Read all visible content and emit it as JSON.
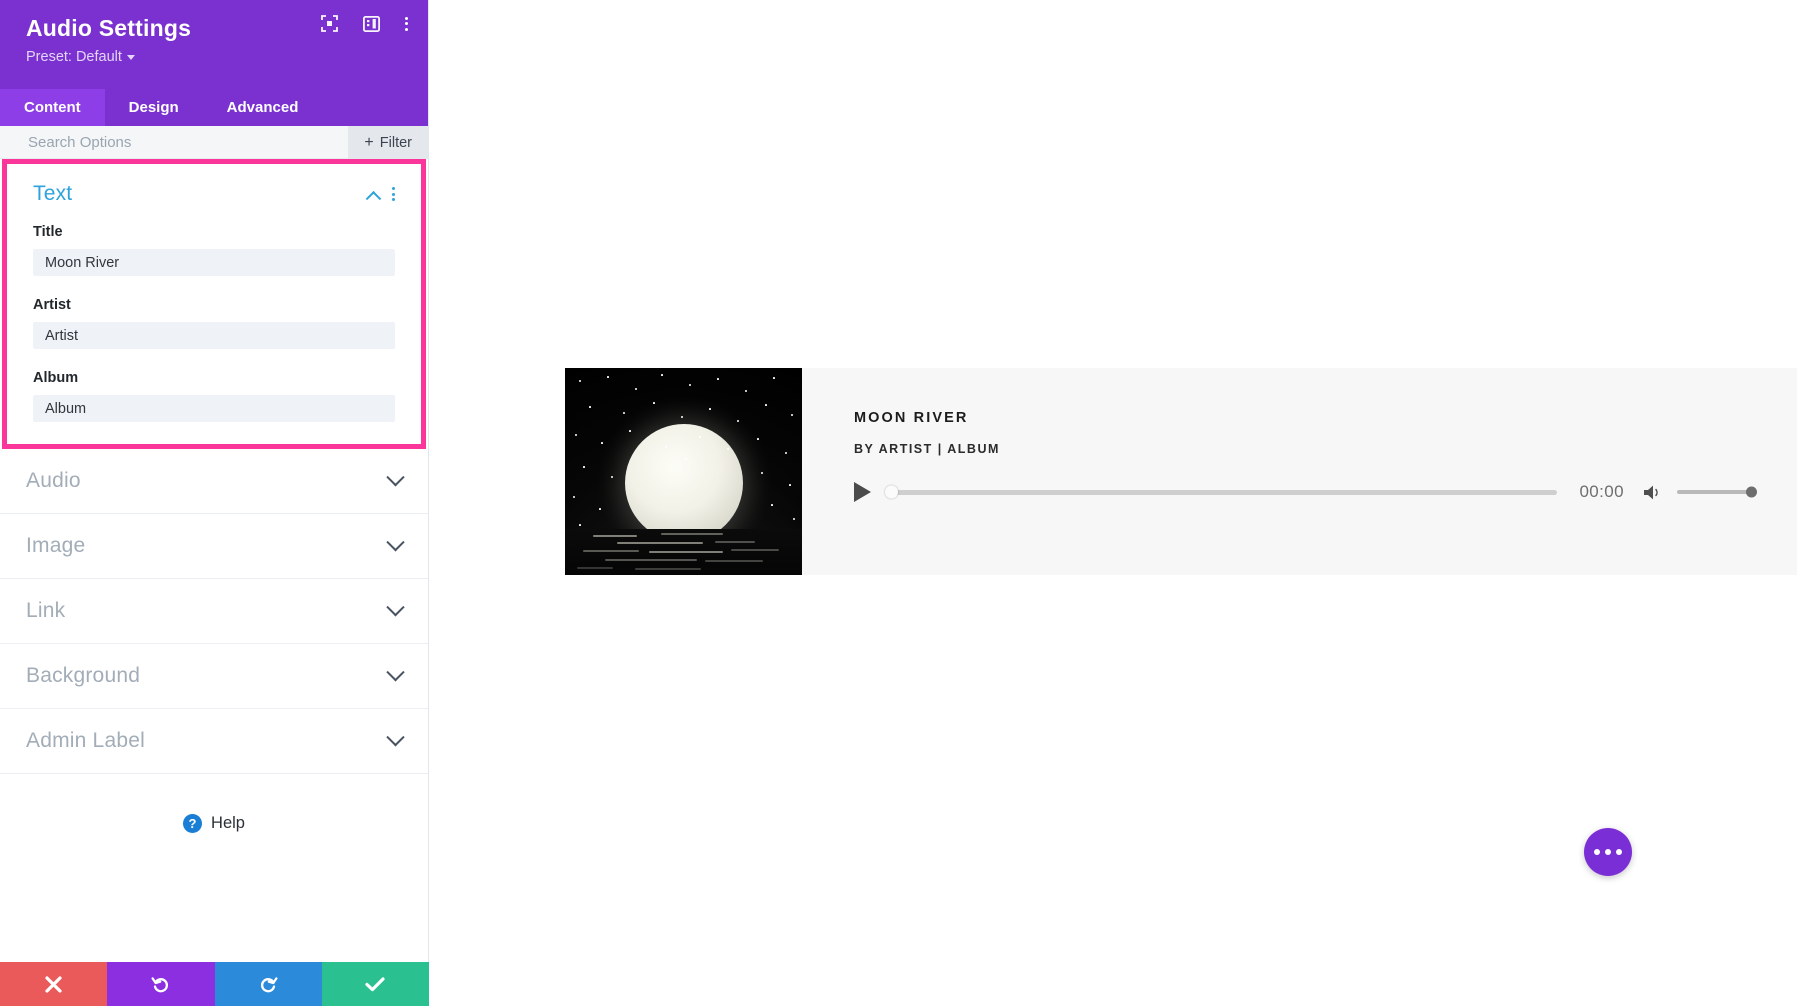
{
  "panel": {
    "title": "Audio Settings",
    "preset_label": "Preset: Default",
    "icons": [
      "focus-target-icon",
      "layout-panel-icon",
      "more-vertical-icon"
    ],
    "tabs": [
      {
        "label": "Content",
        "active": true
      },
      {
        "label": "Design",
        "active": false
      },
      {
        "label": "Advanced",
        "active": false
      }
    ],
    "search": {
      "placeholder": "Search Options",
      "value": ""
    },
    "filter_button": {
      "label": "Filter",
      "icon": "plus-icon"
    },
    "open_section": {
      "title": "Text",
      "collapse_icon": "chevron-up-icon",
      "menu_icon": "more-vertical-icon",
      "fields": [
        {
          "label": "Title",
          "value": "Moon River",
          "placeholder": "Title"
        },
        {
          "label": "Artist",
          "value": "Artist",
          "placeholder": "Artist"
        },
        {
          "label": "Album",
          "value": "Album",
          "placeholder": "Album"
        }
      ]
    },
    "closed_sections": [
      {
        "title": "Audio"
      },
      {
        "title": "Image"
      },
      {
        "title": "Link"
      },
      {
        "title": "Background"
      },
      {
        "title": "Admin Label"
      }
    ],
    "help": {
      "label": "Help",
      "icon": "question-mark-icon"
    },
    "actions": [
      {
        "name": "cancel",
        "icon": "close-x-icon",
        "color": "#eb5a5a"
      },
      {
        "name": "undo",
        "icon": "undo-icon",
        "color": "#8b2fe0"
      },
      {
        "name": "redo",
        "icon": "redo-icon",
        "color": "#2b8ad9"
      },
      {
        "name": "save",
        "icon": "checkmark-icon",
        "color": "#2ac08f"
      }
    ],
    "highlight_color": "#fb369a",
    "header_color": "#7a31cf",
    "accent_color": "#2ea3dc"
  },
  "canvas": {
    "audio_module": {
      "album_art_alt": "moon-over-water-album-art",
      "track_title": "MOON RIVER",
      "track_meta": "BY ARTIST | ALBUM",
      "play_icon": "play-icon",
      "progress_percent": 0,
      "current_time": "00:00",
      "volume_icon": "volume-icon",
      "volume_percent": 100
    },
    "fab": {
      "icon": "more-horizontal-icon",
      "color": "#7a2fd6"
    }
  }
}
